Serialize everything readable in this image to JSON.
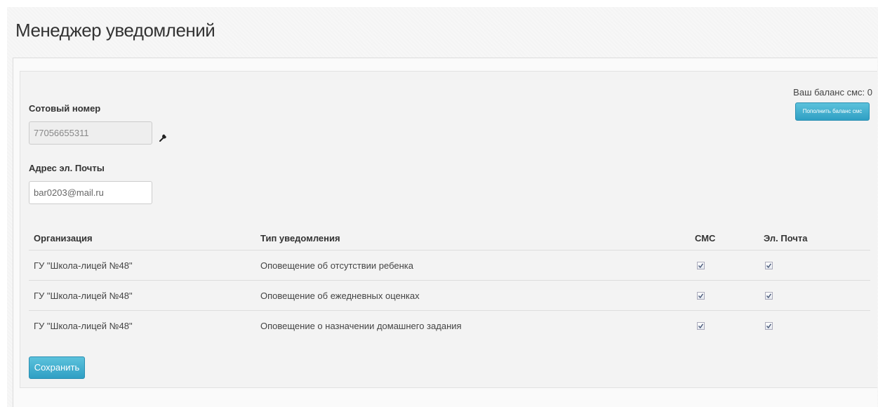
{
  "page": {
    "title": "Менеджер уведомлений"
  },
  "balance": {
    "text": "Ваш баланс смс: 0",
    "button_label": "Пополнить баланс смс"
  },
  "phone": {
    "label": "Сотовый номер",
    "value": "77056655311"
  },
  "email": {
    "label": "Адрес эл. Почты",
    "value": "bar0203@mail.ru"
  },
  "table": {
    "headers": {
      "organization": "Организация",
      "type": "Тип уведомления",
      "sms": "СМС",
      "email": "Эл. Почта"
    },
    "rows": [
      {
        "organization": "ГУ \"Школа-лицей №48\"",
        "type": "Оповещение об отсутствии ребенка",
        "sms": true,
        "email": true
      },
      {
        "organization": "ГУ \"Школа-лицей №48\"",
        "type": "Оповещение об ежедневных оценках",
        "sms": true,
        "email": true
      },
      {
        "organization": "ГУ \"Школа-лицей №48\"",
        "type": "Оповещение о назначении домашнего задания",
        "sms": true,
        "email": true
      }
    ]
  },
  "actions": {
    "save_label": "Сохранить"
  },
  "colors": {
    "accent": "#3aaed2"
  },
  "icons": {
    "edit_phone": "wrench-icon"
  }
}
